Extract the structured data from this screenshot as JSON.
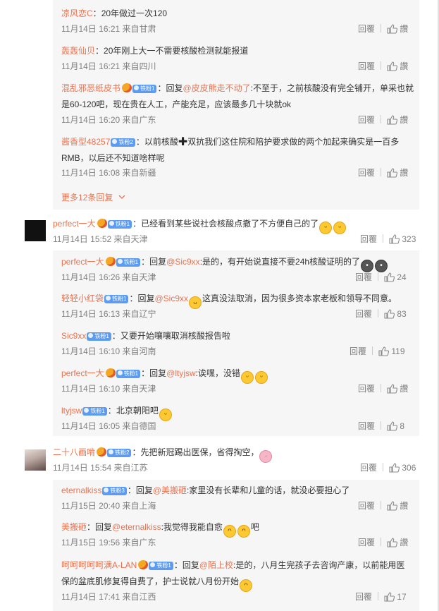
{
  "reply_label": "回覆",
  "like_label": "讚",
  "more_replies": "更多12条回复",
  "threads": [
    {
      "replies": [
        {
          "user": "凉风恋C",
          "sep": "：",
          "text": "20年做过一次120",
          "time": "11月14日 16:21 来自甘肃",
          "likes": "讚"
        },
        {
          "user": "轰轰仙贝",
          "sep": "：",
          "text": "20年刚上大一不需要核酸检测就能报道",
          "time": "11月14日 16:21 来自四川",
          "likes": "讚"
        },
        {
          "user": "混乱邪恶纸皮书",
          "badge": "铁粉1",
          "sep": "：回复",
          "mention": "@皮皮熊走不动了",
          "text1": ":不至于，之前核酸没有完全铺开，单采也就",
          "text2": "是60-120吧，现在贵在人工，产能充足，应该最多几十块就ok",
          "time": "11月14日 16:20 来自广东",
          "likes": "讚"
        },
        {
          "user": "酱香型48257",
          "badge": "铁粉2",
          "sep": "：以前核酸",
          "text1": "双抗我们这住院和陪护要求做的两个加起来确实是一百多",
          "text2": "RMB，以后还不知道啥样呢",
          "time": "11月14日 16:08 来自新疆",
          "likes": "讚"
        }
      ]
    },
    {
      "main": {
        "user": "perfect一大",
        "badge": "铁粉1",
        "text": "：已经看到某些说社会核酸点撤了不方便自己的了",
        "time": "11月14日 15:52 来自天津",
        "likes": "323"
      },
      "replies": [
        {
          "user": "perfect一大",
          "badge": "铁粉1",
          "sep": "：回复",
          "mention": "@Sic9xx",
          "text": ":是的，有开始说直接不要24h核酸证明的了",
          "time": "11月14日 16:26 来自天津",
          "likes": "24"
        },
        {
          "user": "轻轻小红袋",
          "badge": "铁粉1",
          "sep": "：回复",
          "mention": "@Sic9xx",
          "text": "这真没法取消，因为很多资本家老板和领导不同意。",
          "time": "11月14日 16:13 来自辽宁",
          "likes": "83"
        },
        {
          "user": "Sic9xx",
          "badge": "铁粉1",
          "sep": "：",
          "text": "又要开始嚷嚷取消核酸报告啦",
          "time": "11月14日 16:10 来自河南",
          "likes": "119"
        },
        {
          "user": "perfect一大",
          "badge": "铁粉1",
          "sep": "：回复",
          "mention": "@ltyjsw",
          "text": ":诶嘿，没错",
          "time": "11月14日 16:10 来自天津",
          "likes": "讚"
        },
        {
          "user": "ltyjsw",
          "badge": "铁粉1",
          "sep": "：",
          "text": "北京朝阳吧",
          "time": "11月14日 16:05 来自德国",
          "likes": "8"
        }
      ]
    },
    {
      "main": {
        "user": "二十八画啃",
        "badge": "铁粉2",
        "text": "：先把新冠踢出医保，省得掏空，",
        "time": "11月14日 15:54 来自江苏",
        "likes": "306"
      },
      "replies": [
        {
          "user": "eternalkiss",
          "badge": "铁粉3",
          "sep": "：回复",
          "mention": "@美搬砸",
          "text": ":家里没有长辈和儿童的话，就没必要担心了",
          "time": "11月15日 20:40 来自上海",
          "likes": "讚"
        },
        {
          "user": "美搬砸",
          "sep": "：回复",
          "mention": "@eternalkiss",
          "text": ":我觉得我能自愈",
          "text_end": "吧",
          "time": "11月15日 19:56 来自广东",
          "likes": "讚"
        },
        {
          "user": "呵呵呵呵呵满A-LAN",
          "badge": "铁粉1",
          "sep": "：回复",
          "mention": "@陌上校",
          "text1": ":是的，八月生完孩子去咨询产康，以前能用医",
          "text2": "保的盆底肌修复得自费了，护士说就八月份开始",
          "time": "11月14日 17:41 来自江西",
          "likes": "17"
        }
      ]
    }
  ]
}
